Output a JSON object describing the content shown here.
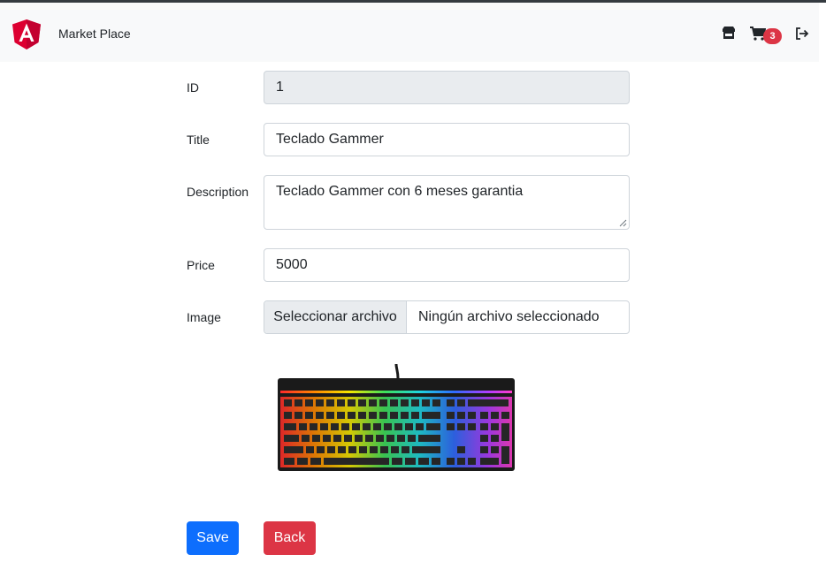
{
  "navbar": {
    "brand": "Market Place",
    "cart_count": "3",
    "icons": {
      "logo": "angular-logo",
      "store": "store-icon",
      "cart": "cart-icon",
      "logout": "logout-icon"
    }
  },
  "form": {
    "id": {
      "label": "ID",
      "value": "1"
    },
    "title": {
      "label": "Title",
      "value": "Teclado Gammer"
    },
    "description": {
      "label": "Description",
      "value": "Teclado Gammer con 6 meses garantia"
    },
    "price": {
      "label": "Price",
      "value": "5000"
    },
    "image": {
      "label": "Image",
      "button": "Seleccionar archivo",
      "filename": "Ningún archivo seleccionado"
    }
  },
  "actions": {
    "save": "Save",
    "back": "Back"
  },
  "colors": {
    "primary": "#0d6efd",
    "danger": "#dc3545",
    "navbar": "#f8f9fa",
    "angular": "#dd0031"
  }
}
